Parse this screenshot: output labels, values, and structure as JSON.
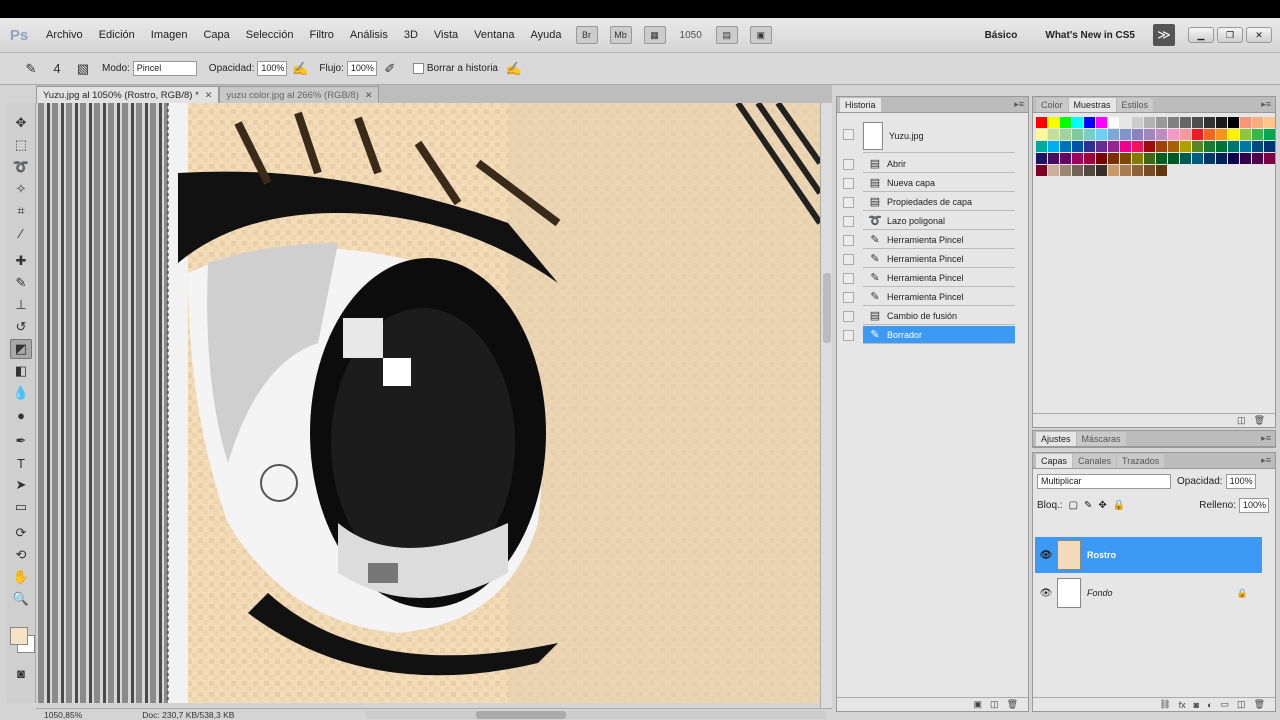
{
  "app": {
    "logo": "Ps"
  },
  "menu": [
    "Archivo",
    "Edición",
    "Imagen",
    "Capa",
    "Selección",
    "Filtro",
    "Análisis",
    "3D",
    "Vista",
    "Ventana",
    "Ayuda"
  ],
  "menubar": {
    "br_label": "Br",
    "mb_label": "Mb",
    "zoom": "1050",
    "workspace_basic": "Básico",
    "workspace_new": "What's New in CS5",
    "more": "≫"
  },
  "options": {
    "mode_label": "Modo:",
    "mode_value": "Pincel",
    "opacity_label": "Opacidad:",
    "opacity_value": "100%",
    "flow_label": "Flujo:",
    "flow_value": "100%",
    "erase_history_label": "Borrar a historia",
    "brush_size": "4"
  },
  "tabs": [
    {
      "label": "Yuzu.jpg al 1050% (Rostro, RGB/8) *",
      "active": true
    },
    {
      "label": "yuzu color.jpg al 266% (RGB/8)",
      "active": false
    }
  ],
  "status": {
    "zoom": "1050,85%",
    "doc": "Doc: 230,7 KB/538,3 KB"
  },
  "history": {
    "tab": "Historia",
    "snapshot": "Yuzu.jpg",
    "items": [
      {
        "label": "Abrir",
        "icon": "doc-icon"
      },
      {
        "label": "Nueva capa",
        "icon": "doc-icon"
      },
      {
        "label": "Propiedades de capa",
        "icon": "doc-icon"
      },
      {
        "label": "Lazo poligonal",
        "icon": "lasso-icon"
      },
      {
        "label": "Herramienta Pincel",
        "icon": "brush-icon"
      },
      {
        "label": "Herramienta Pincel",
        "icon": "brush-icon"
      },
      {
        "label": "Herramienta Pincel",
        "icon": "brush-icon"
      },
      {
        "label": "Herramienta Pincel",
        "icon": "brush-icon"
      },
      {
        "label": "Cambio de fusión",
        "icon": "doc-icon"
      },
      {
        "label": "Borrador",
        "icon": "brush-icon",
        "selected": true
      }
    ]
  },
  "swatches_panel": {
    "tabs": [
      "Color",
      "Muestras",
      "Estilos"
    ],
    "active": "Muestras"
  },
  "adjust_panel": {
    "tabs": [
      "Ajustes",
      "Máscaras"
    ]
  },
  "layers_panel": {
    "tabs": [
      "Capas",
      "Canales",
      "Trazados"
    ],
    "blend_mode": "Multiplicar",
    "opacity_label": "Opacidad:",
    "opacity_value": "100%",
    "lock_label": "Bloq.:",
    "fill_label": "Relleno:",
    "fill_value": "100%",
    "layers": [
      {
        "name": "Rostro",
        "selected": true
      },
      {
        "name": "Fondo",
        "selected": false,
        "locked": true
      }
    ]
  },
  "colors": {
    "selection": "#3c9af5",
    "foreground": "#f6e2c4",
    "skin": "#f3dcb7"
  }
}
